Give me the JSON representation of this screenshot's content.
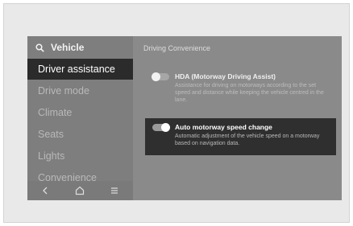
{
  "colors": {
    "screen_bg": "#8a8a8a",
    "active_item_bg": "#2b2b2b",
    "selected_option_bg": "#2f2f2f"
  },
  "sidebar": {
    "title": "Vehicle",
    "search_icon": "search-icon",
    "items": [
      {
        "label": "Driver assistance",
        "active": true
      },
      {
        "label": "Drive mode",
        "active": false
      },
      {
        "label": "Climate",
        "active": false
      },
      {
        "label": "Seats",
        "active": false
      },
      {
        "label": "Lights",
        "active": false
      },
      {
        "label": "Convenience",
        "active": false
      }
    ],
    "bottom_nav": [
      "back-icon",
      "home-icon",
      "menu-icon"
    ]
  },
  "main": {
    "title": "Driving Convenience",
    "options": [
      {
        "title": "HDA (Motorway Driving Assist)",
        "description": "Assistance for driving on motorways according to the set speed and distance while keeping the vehicle centred in the lane.",
        "enabled": false,
        "selected": false
      },
      {
        "title": "Auto motorway speed change",
        "description": "Automatic adjustment of the vehicle speed on a motorway based on navigation data.",
        "enabled": true,
        "selected": true
      }
    ]
  }
}
